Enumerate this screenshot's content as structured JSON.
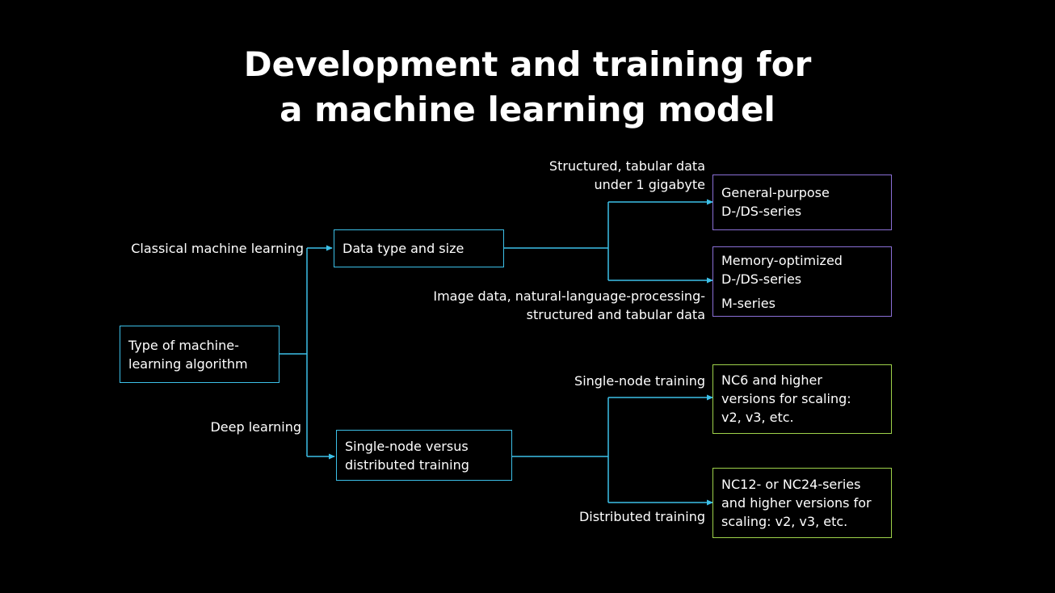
{
  "title": {
    "line1": "Development and training for",
    "line2": "a machine learning model"
  },
  "root": {
    "line1": "Type of machine-",
    "line2": "learning algorithm"
  },
  "branches": {
    "classical": "Classical machine learning",
    "deep": "Deep learning"
  },
  "mid": {
    "data_type": "Data type and size",
    "training_line1": "Single-node versus",
    "training_line2": "distributed training"
  },
  "conditions": {
    "structured_line1": "Structured, tabular data",
    "structured_line2": "under 1 gigabyte",
    "image_line1": "Image data, natural-language-processing-",
    "image_line2": "structured and tabular data",
    "single_node": "Single-node training",
    "distributed": "Distributed training"
  },
  "results": {
    "general_line1": "General-purpose",
    "general_line2": "D-/DS-series",
    "memory_line1": "Memory-optimized",
    "memory_line2": "D-/DS-series",
    "memory_line3": "M-series",
    "nc6_line1": "NC6 and higher",
    "nc6_line2": "versions for scaling:",
    "nc6_line3": "v2, v3, etc.",
    "nc12_line1": "NC12- or NC24-series",
    "nc12_line2": "and higher versions for",
    "nc12_line3": "scaling: v2, v3, etc."
  },
  "colors": {
    "background": "#000000",
    "connector": "#3cc0e8",
    "cpu_box": "#8a6fd6",
    "gpu_box": "#9ed24a"
  }
}
